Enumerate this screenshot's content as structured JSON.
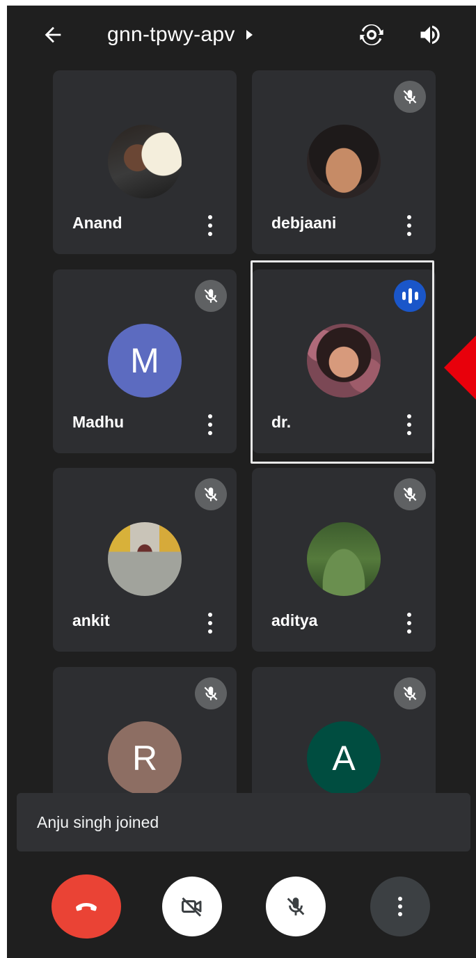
{
  "header": {
    "meeting_code": "gnn-tpwy-apv",
    "icons": [
      "back-arrow-icon",
      "caret-right-icon",
      "switch-camera-icon",
      "speaker-icon"
    ]
  },
  "participants": [
    {
      "name": "Anand",
      "muted": false,
      "avatar_type": "photo"
    },
    {
      "name": "debjaani",
      "muted": true,
      "avatar_type": "photo"
    },
    {
      "name": "Madhu",
      "muted": true,
      "avatar_type": "initial",
      "initial": "M",
      "color": "#5c6bc0"
    },
    {
      "name": "dr.",
      "muted": false,
      "speaking": true,
      "avatar_type": "photo"
    },
    {
      "name": "ankit",
      "muted": true,
      "avatar_type": "photo"
    },
    {
      "name": "aditya",
      "muted": true,
      "avatar_type": "photo"
    },
    {
      "name": "",
      "muted": true,
      "avatar_type": "initial",
      "initial": "R",
      "color": "#8d6e63"
    },
    {
      "name": "",
      "muted": true,
      "avatar_type": "initial",
      "initial": "A",
      "color": "#004d40"
    }
  ],
  "toast": {
    "text": "Anju singh joined"
  },
  "controls": {
    "icons": [
      "end-call-icon",
      "camera-off-icon",
      "mic-off-icon",
      "more-options-icon"
    ],
    "end_color": "#ea4335"
  },
  "colors": {
    "background": "#1f1f1f",
    "tile": "#2d2e31",
    "mute_badge": "#5f6163",
    "speaking_badge": "#1a56c9",
    "pointer": "#e8000b"
  }
}
